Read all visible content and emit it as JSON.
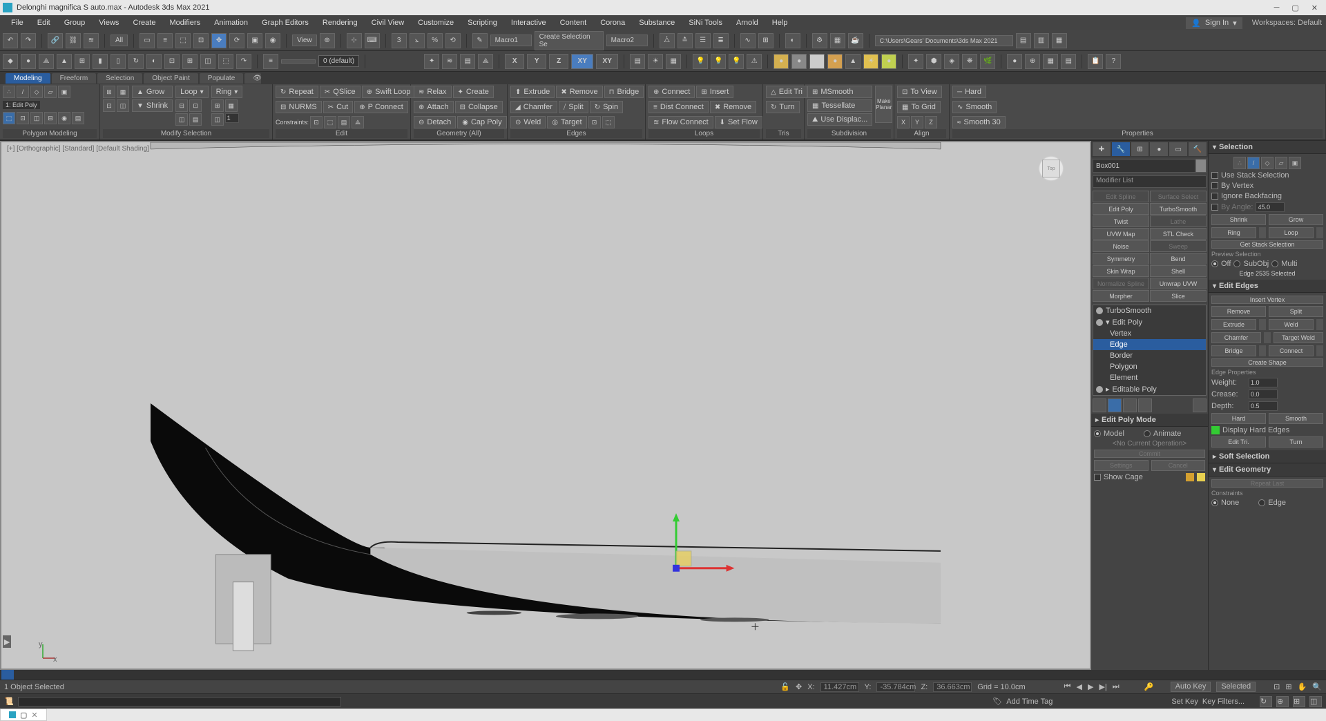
{
  "title": "Delonghi magnifica S auto.max - Autodesk 3ds Max 2021",
  "signin": "Sign In",
  "workspaces_label": "Workspaces:",
  "workspaces_value": "Default",
  "menus": [
    "File",
    "Edit",
    "Group",
    "Views",
    "Create",
    "Modifiers",
    "Animation",
    "Graph Editors",
    "Rendering",
    "Civil View",
    "Customize",
    "Scripting",
    "Interactive",
    "Content",
    "Corona",
    "Substance",
    "SiNi Tools",
    "Arnold",
    "Help"
  ],
  "toolbar1": {
    "all": "All",
    "view": "View",
    "macro1": "Macro1",
    "create_sel": "Create Selection Se",
    "macro2": "Macro2",
    "path": "C:\\Users\\Gears' Documents\\3ds Max 2021"
  },
  "toolbar2": {
    "axis": [
      "X",
      "Y",
      "Z",
      "XY",
      "XY"
    ],
    "default": "0 (default)"
  },
  "ribbon_tabs": [
    "Modeling",
    "Freeform",
    "Selection",
    "Object Paint",
    "Populate"
  ],
  "ribbon": {
    "poly_sel_title": "1: Edit Poly",
    "grow": "Grow",
    "shrink": "Shrink",
    "loop": "Loop",
    "ring": "Ring",
    "repeat": "Repeat",
    "qslice": "QSlice",
    "swiftloop": "Swift Loop",
    "nurms": "NURMS",
    "cut": "Cut",
    "pconnect": "P Connect",
    "constraints": "Constraints:",
    "relax": "Relax",
    "create": "Create",
    "attach": "Attach",
    "collapse": "Collapse",
    "detach": "Detach",
    "cappoly": "Cap Poly",
    "extrude": "Extrude",
    "remove": "Remove",
    "bridge": "Bridge",
    "chamfer": "Chamfer",
    "split": "Split",
    "spin": "Spin",
    "weld": "Weld",
    "target": "Target",
    "connect": "Connect",
    "insert": "Insert",
    "distconnect": "Dist Connect",
    "remove2": "Remove",
    "flowconnect": "Flow Connect",
    "setflow": "Set Flow",
    "editri": "Edit Tri",
    "turn": "Turn",
    "msmooth": "MSmooth",
    "tessellate": "Tessellate",
    "usedisplac": "Use Displac...",
    "makeplanar": "Make\nPlanar",
    "toview": "To View",
    "togrid": "To Grid",
    "x": "X",
    "y": "Y",
    "z": "Z",
    "hard": "Hard",
    "smooth": "Smooth",
    "smooth30": "Smooth 30"
  },
  "ribbon_groups": [
    "Polygon Modeling",
    "Modify Selection",
    "Edit",
    "Geometry (All)",
    "Edges",
    "Loops",
    "Tris",
    "Subdivision",
    "Align",
    "Properties"
  ],
  "viewport": {
    "label": "[+] [Orthographic] [Standard] [Default Shading]",
    "cube": "Top"
  },
  "object_name": "Box001",
  "modifier_list": "Modifier List",
  "mod_buttons": [
    {
      "label": "Edit Spline",
      "disabled": true
    },
    {
      "label": "Surface Select",
      "disabled": true
    },
    {
      "label": "Edit Poly",
      "disabled": false
    },
    {
      "label": "TurboSmooth",
      "disabled": false
    },
    {
      "label": "Twist",
      "disabled": false
    },
    {
      "label": "Lathe",
      "disabled": true
    },
    {
      "label": "UVW Map",
      "disabled": false
    },
    {
      "label": "STL Check",
      "disabled": false
    },
    {
      "label": "Noise",
      "disabled": false
    },
    {
      "label": "Sweep",
      "disabled": true
    },
    {
      "label": "Symmetry",
      "disabled": false
    },
    {
      "label": "Bend",
      "disabled": false
    },
    {
      "label": "Skin Wrap",
      "disabled": false
    },
    {
      "label": "Shell",
      "disabled": false
    },
    {
      "label": "Normalize Spline",
      "disabled": true
    },
    {
      "label": "Unwrap UVW",
      "disabled": false
    },
    {
      "label": "Morpher",
      "disabled": false
    },
    {
      "label": "Slice",
      "disabled": false
    }
  ],
  "mod_stack": [
    {
      "label": "TurboSmooth",
      "sub": false,
      "sel": false,
      "bulb": true
    },
    {
      "label": "Edit Poly",
      "sub": false,
      "sel": false,
      "bulb": true,
      "expand": true
    },
    {
      "label": "Vertex",
      "sub": true,
      "sel": false
    },
    {
      "label": "Edge",
      "sub": true,
      "sel": true
    },
    {
      "label": "Border",
      "sub": true,
      "sel": false
    },
    {
      "label": "Polygon",
      "sub": true,
      "sel": false
    },
    {
      "label": "Element",
      "sub": true,
      "sel": false
    },
    {
      "label": "Editable Poly",
      "sub": false,
      "sel": false,
      "bulb": false,
      "expand": false
    }
  ],
  "edit_poly_mode": {
    "title": "Edit Poly Mode",
    "model": "Model",
    "animate": "Animate",
    "noop": "<No Current Operation>",
    "commit": "Commit",
    "settings": "Settings",
    "cancel": "Cancel",
    "showcage": "Show Cage"
  },
  "selection": {
    "title": "Selection",
    "use_stack": "Use Stack Selection",
    "by_vertex": "By Vertex",
    "ignore_back": "Ignore Backfacing",
    "by_angle": "By Angle:",
    "by_angle_val": "45.0",
    "shrink": "Shrink",
    "grow": "Grow",
    "ring": "Ring",
    "loop": "Loop",
    "get_stack": "Get Stack Selection",
    "preview": "Preview Selection",
    "off": "Off",
    "subobj": "SubObj",
    "multi": "Multi",
    "status": "Edge 2535 Selected"
  },
  "edit_edges": {
    "title": "Edit Edges",
    "insert_vertex": "Insert Vertex",
    "remove": "Remove",
    "split": "Split",
    "extrude": "Extrude",
    "weld": "Weld",
    "chamfer": "Chamfer",
    "target_weld": "Target Weld",
    "bridge": "Bridge",
    "connect": "Connect",
    "create_shape": "Create Shape",
    "edge_props": "Edge Properties",
    "weight": "Weight:",
    "weight_val": "1.0",
    "crease": "Crease:",
    "crease_val": "0.0",
    "depth": "Depth:",
    "depth_val": "0.5",
    "hard": "Hard",
    "smooth": "Smooth",
    "display_hard": "Display Hard Edges",
    "edit_tri": "Edit Tri.",
    "turn": "Turn"
  },
  "soft_sel": "Soft Selection",
  "edit_geom": {
    "title": "Edit Geometry",
    "repeat": "Repeat Last",
    "constraints": "Constraints",
    "none": "None",
    "edge": "Edge"
  },
  "status": {
    "objects": "1 Object Selected",
    "x_label": "X:",
    "x": "11.427cm",
    "y_label": "Y:",
    "y": "-35.784cm",
    "z_label": "Z:",
    "z": "36.663cm",
    "grid": "Grid = 10.0cm",
    "autokey": "Auto Key",
    "selected": "Selected",
    "setkey": "Set Key",
    "keyfilters": "Key Filters...",
    "addtimetag": "Add Time Tag"
  }
}
